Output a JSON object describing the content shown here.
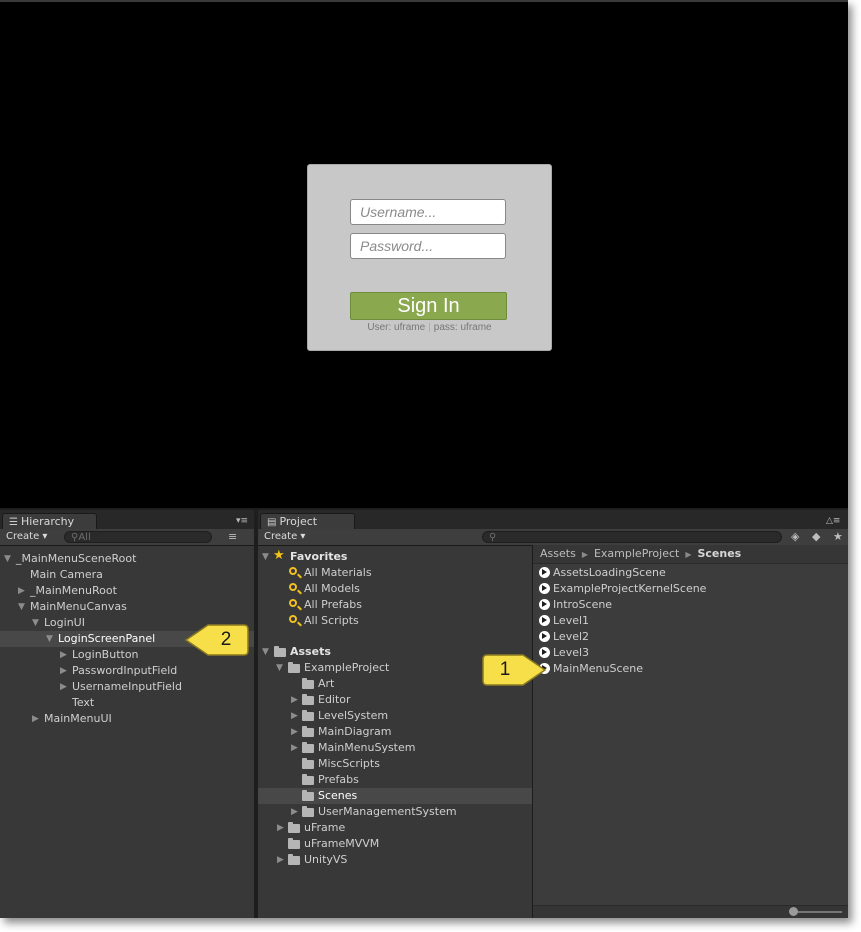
{
  "login": {
    "username_placeholder": "Username...",
    "password_placeholder": "Password...",
    "signin_label": "Sign In",
    "hint_user": "User: uframe",
    "hint_sep": "|",
    "hint_pass": "pass: uframe"
  },
  "hierarchy": {
    "tab_label": "Hierarchy",
    "create_label": "Create ▾",
    "search_placeholder": "All",
    "items": [
      {
        "label": "_MainMenuSceneRoot"
      },
      {
        "label": "Main Camera"
      },
      {
        "label": "_MainMenuRoot"
      },
      {
        "label": "MainMenuCanvas"
      },
      {
        "label": "LoginUI"
      },
      {
        "label": "LoginScreenPanel"
      },
      {
        "label": "LoginButton"
      },
      {
        "label": "PasswordInputField"
      },
      {
        "label": "UsernameInputField"
      },
      {
        "label": "Text"
      },
      {
        "label": "MainMenuUI"
      }
    ]
  },
  "project": {
    "tab_label": "Project",
    "create_label": "Create ▾",
    "favorites": {
      "header": "Favorites",
      "items": [
        "All Materials",
        "All Models",
        "All Prefabs",
        "All Scripts"
      ]
    },
    "assets": {
      "header": "Assets",
      "items": [
        {
          "label": "ExampleProject"
        },
        {
          "label": "Art"
        },
        {
          "label": "Editor"
        },
        {
          "label": "LevelSystem"
        },
        {
          "label": "MainDiagram"
        },
        {
          "label": "MainMenuSystem"
        },
        {
          "label": "MiscScripts"
        },
        {
          "label": "Prefabs"
        },
        {
          "label": "Scenes"
        },
        {
          "label": "UserManagementSystem"
        },
        {
          "label": "uFrame"
        },
        {
          "label": "uFrameMVVM"
        },
        {
          "label": "UnityVS"
        }
      ]
    },
    "breadcrumb": [
      "Assets",
      "ExampleProject",
      "Scenes"
    ],
    "scenes": [
      "AssetsLoadingScene",
      "ExampleProjectKernelScene",
      "IntroScene",
      "Level1",
      "Level2",
      "Level3",
      "MainMenuScene"
    ]
  },
  "callouts": {
    "one": "1",
    "two": "2",
    "fill_color": "#f7df4a",
    "stroke_color": "#8a7a20"
  }
}
